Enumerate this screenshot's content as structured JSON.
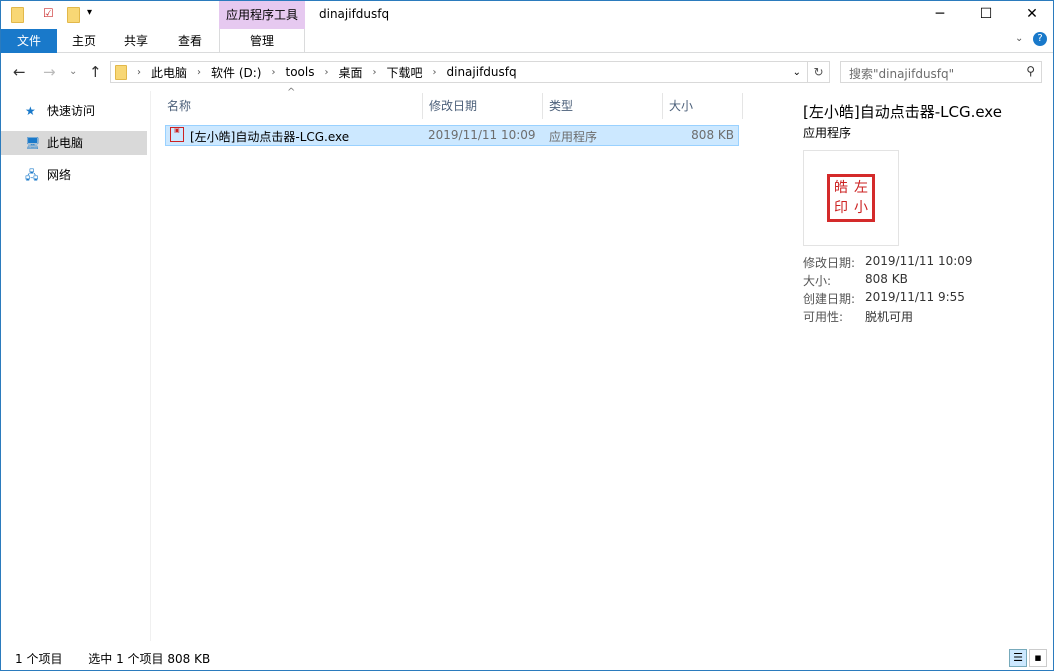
{
  "titlebar": {
    "title": "dinajifdusfq",
    "context_tab": "应用程序工具",
    "minimize": "─",
    "maximize": "☐",
    "close": "✕"
  },
  "ribbon": {
    "tabs": [
      "文件",
      "主页",
      "共享",
      "查看",
      "管理"
    ]
  },
  "nav": {
    "breadcrumb": [
      "此电脑",
      "软件 (D:)",
      "tools",
      "桌面",
      "下载吧",
      "dinajifdusfq"
    ],
    "search_placeholder": "搜索\"dinajifdusfq\""
  },
  "sidebar": {
    "items": [
      {
        "label": "快速访问"
      },
      {
        "label": "此电脑"
      },
      {
        "label": "网络"
      }
    ]
  },
  "columns": [
    "名称",
    "修改日期",
    "类型",
    "大小"
  ],
  "files": [
    {
      "name": "[左小皓]自动点击器-LCG.exe",
      "modified": "2019/11/11 10:09",
      "type": "应用程序",
      "size": "808 KB"
    }
  ],
  "preview": {
    "title": "[左小皓]自动点击器-LCG.exe",
    "type": "应用程序",
    "seal_text": "左小皓印",
    "props": [
      {
        "label": "修改日期:",
        "value": "2019/11/11 10:09"
      },
      {
        "label": "大小:",
        "value": "808 KB"
      },
      {
        "label": "创建日期:",
        "value": "2019/11/11 9:55"
      },
      {
        "label": "可用性:",
        "value": "脱机可用"
      }
    ]
  },
  "status": {
    "count": "1 个项目",
    "selected": "选中 1 个项目  808 KB"
  },
  "colors": {
    "accent": "#1979ca",
    "selection": "#cce8ff",
    "context_tab": "#e6c9f0"
  }
}
